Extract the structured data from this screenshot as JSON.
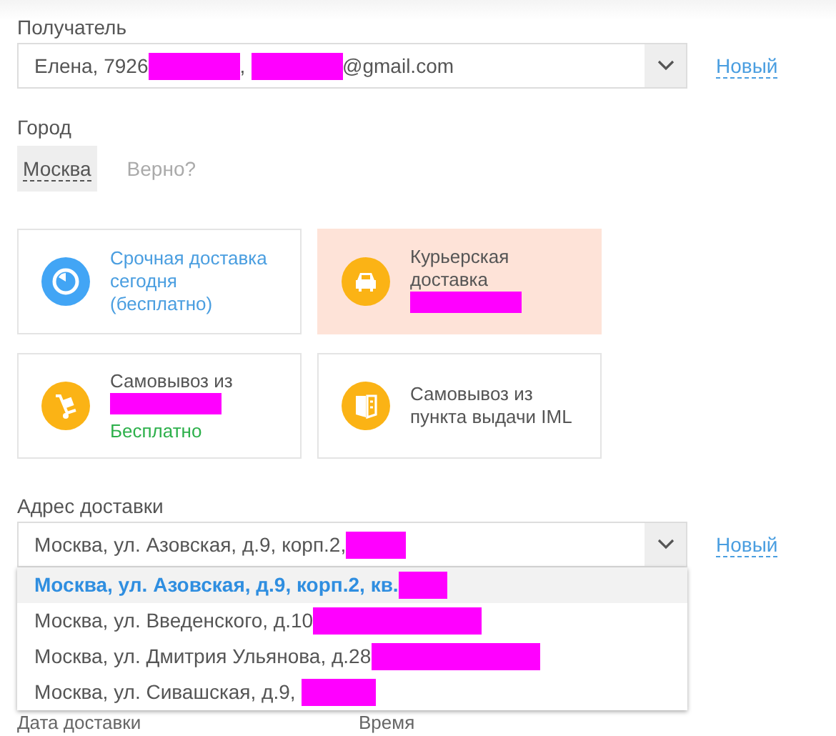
{
  "recipient": {
    "label": "Получатель",
    "value": [
      {
        "kind": "text",
        "text": "Елена, 7926"
      },
      {
        "kind": "redaction"
      },
      {
        "kind": "text",
        "text": ", "
      },
      {
        "kind": "redaction"
      },
      {
        "kind": "text",
        "text": "@gmail.com"
      }
    ],
    "new_link": "Новый"
  },
  "city": {
    "label": "Город",
    "value": "Москва",
    "confirm": "Верно?"
  },
  "delivery_options": [
    {
      "kind": "stopwatch",
      "color": "#42a5f5",
      "lines": [
        [
          {
            "kind": "text",
            "text": "Срочная доставка сегодня (бесплатно)"
          }
        ]
      ],
      "accent": true,
      "selected": false
    },
    {
      "kind": "car",
      "color": "#fbb315",
      "lines": [
        [
          {
            "kind": "text",
            "text": "Курьерская доставка"
          }
        ],
        [
          {
            "kind": "redaction"
          }
        ]
      ],
      "accent": false,
      "selected": true
    },
    {
      "kind": "cart",
      "color": "#fbb315",
      "lines": [
        [
          {
            "kind": "text",
            "text": "Самовывоз из"
          }
        ],
        [
          {
            "kind": "redaction"
          }
        ]
      ],
      "note": "Бесплатно",
      "accent": false,
      "selected": false
    },
    {
      "kind": "pickup",
      "color": "#fbb315",
      "lines": [
        [
          {
            "kind": "text",
            "text": "Самовывоз из пункта выдачи IML"
          }
        ]
      ],
      "accent": false,
      "selected": false
    }
  ],
  "address": {
    "label": "Адрес доставки",
    "value": [
      {
        "kind": "text",
        "text": "Москва, ул. Азовская, д.9, корп.2,"
      },
      {
        "kind": "redaction"
      }
    ],
    "new_link": "Новый",
    "options": [
      {
        "selected": true,
        "parts": [
          {
            "kind": "text",
            "text": "Москва, ул. Азовская, д.9, корп.2, кв."
          },
          {
            "kind": "redaction"
          }
        ]
      },
      {
        "selected": false,
        "parts": [
          {
            "kind": "text",
            "text": "Москва, ул. Введенского, д.10"
          },
          {
            "kind": "redaction"
          }
        ]
      },
      {
        "selected": false,
        "parts": [
          {
            "kind": "text",
            "text": "Москва, ул. Дмитрия Ульянова, д.28"
          },
          {
            "kind": "redaction"
          }
        ]
      },
      {
        "selected": false,
        "parts": [
          {
            "kind": "text",
            "text": "Москва, ул. Сивашская, д.9, "
          },
          {
            "kind": "redaction"
          }
        ]
      }
    ]
  },
  "bottom_labels": [
    "Дата доставки",
    "Время"
  ]
}
